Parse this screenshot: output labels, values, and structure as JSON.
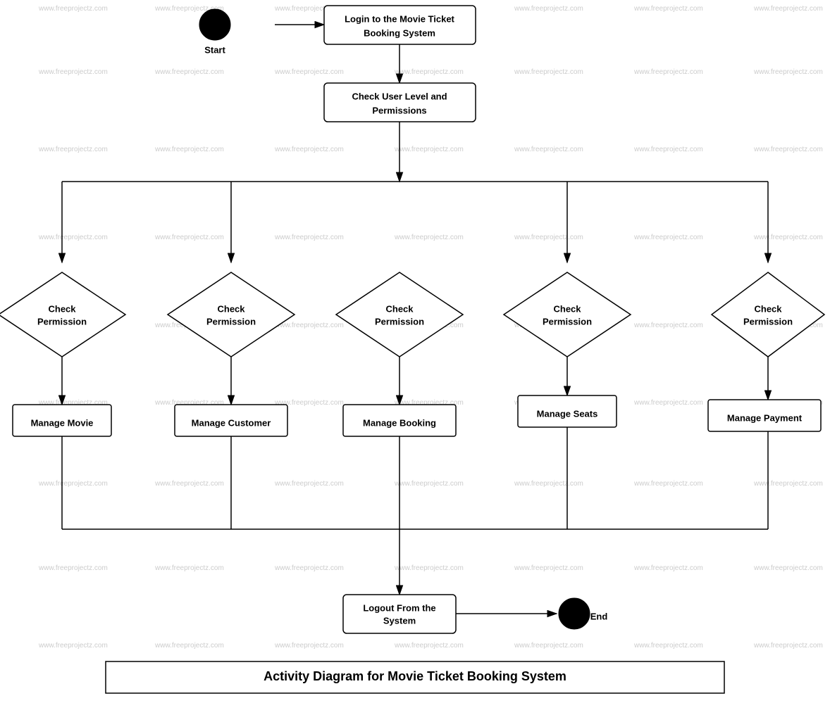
{
  "diagram": {
    "title": "Activity Diagram for Movie Ticket Booking System",
    "watermark": "www.freeprojectz.com",
    "nodes": {
      "start": "Start",
      "login": "Login to the Movie Ticket\nBooking System",
      "checkUserLevel": "Check User Level and\nPermissions",
      "checkPerm1": "Check\nPermission",
      "checkPerm2": "Check\nPermission",
      "checkPerm3": "Check\nPermission",
      "checkPerm4": "Check\nPermission",
      "checkPerm5": "Check\nPermission",
      "manageMovie": "Manage Movie",
      "manageCustomer": "Manage Customer",
      "manageBooking": "Manage Booking",
      "manageSeats": "Manage Seats",
      "managePayment": "Manage Payment",
      "logout": "Logout From the\nSystem",
      "end": "End"
    }
  }
}
